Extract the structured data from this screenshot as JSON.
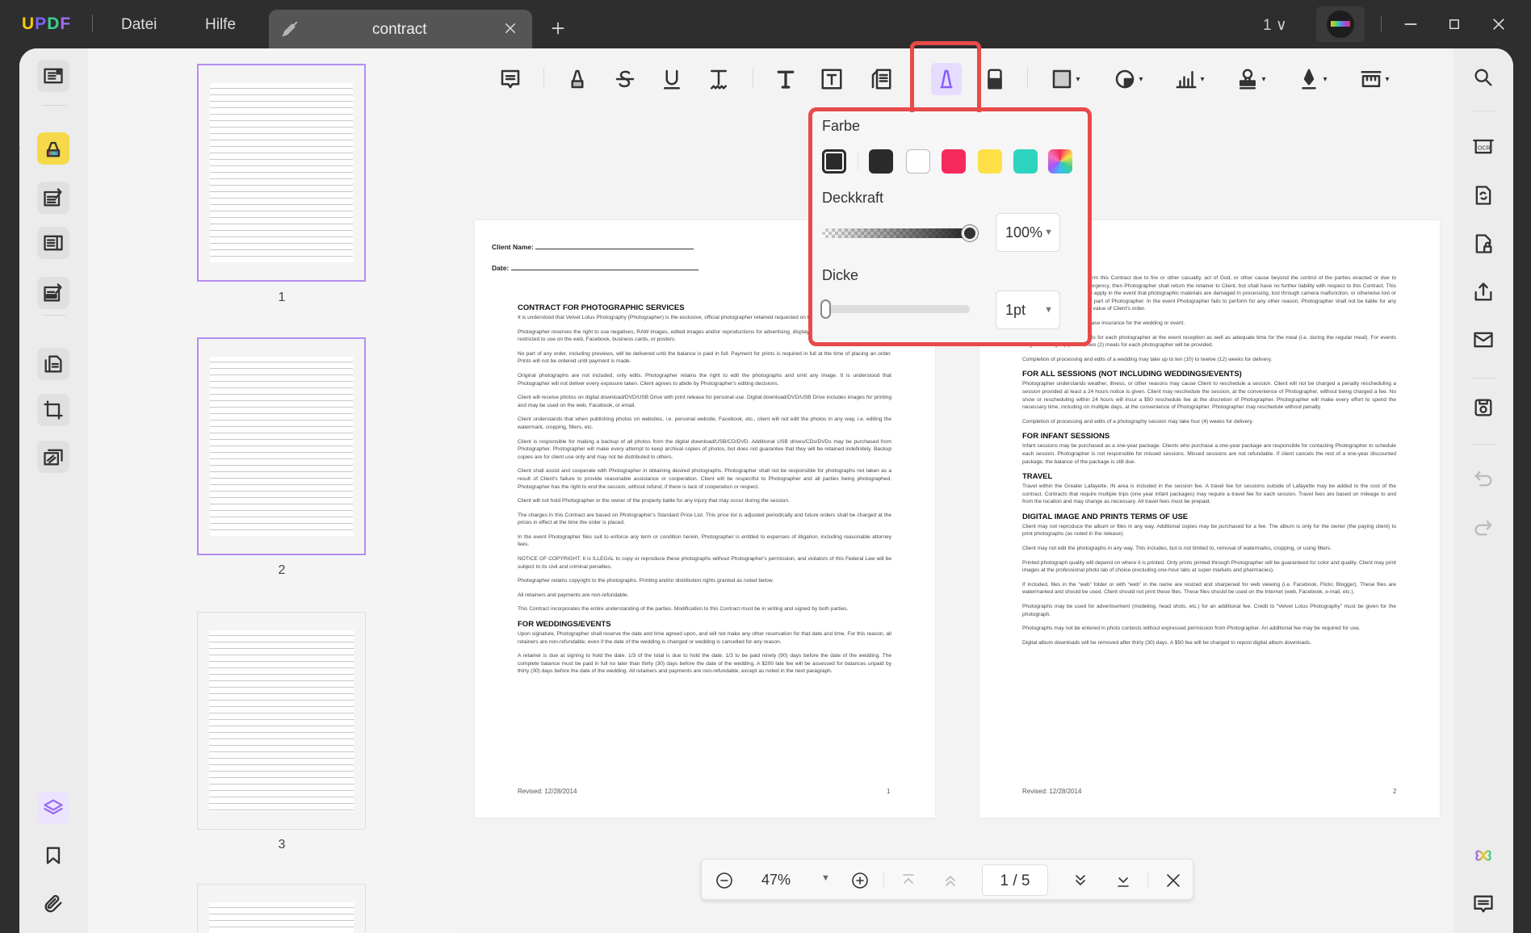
{
  "app": {
    "logo": "UPDF",
    "menu": [
      "Datei",
      "Hilfe"
    ],
    "tab_title": "contract",
    "page_count_indicator": "1"
  },
  "colors": {
    "accent": "#e84a4a",
    "selected_tool_bg": "#e6dcff",
    "highlight_left": "#f6d94a"
  },
  "toolbar": {
    "tools": [
      "comment-icon",
      "highlighter-icon",
      "strikethrough-icon",
      "underline-icon",
      "squiggly-icon",
      "text-icon",
      "textbox-icon",
      "callout-icon",
      "pencil-icon",
      "eraser-icon",
      "rectangle-icon",
      "shape-icon",
      "chart-icon",
      "stamp-icon",
      "signature-icon",
      "ruler-icon"
    ],
    "selected": "pencil-icon"
  },
  "popup": {
    "color_label": "Farbe",
    "swatches": [
      "#2b2b2b",
      "#2b2b2b",
      "#ffffff",
      "#f5295c",
      "#fde047",
      "#2dd4bf",
      "rainbow"
    ],
    "opacity_label": "Deckkraft",
    "opacity_value": "100%",
    "opacity_fraction": 1.0,
    "thickness_label": "Dicke",
    "thickness_value": "1pt"
  },
  "thumbnails": {
    "labels": [
      "1",
      "2",
      "3"
    ]
  },
  "page1": {
    "client_name": "Client Name:",
    "date": "Date:",
    "title": "CONTRACT FOR PHOTOGRAPHIC SERVICES",
    "paragraphs": [
      "It is understood that Velvet Lotus Photography (Photographer) is the exclusive, official photographer retained requested on this contract.",
      "Photographer reserves the right to use negatives, RAW images, edited images and/or reproductions for advertising, display, publication or other purposes, not restricted to use on the web, Facebook, business cards, or posters.",
      "No part of any order, including previews, will be delivered until the balance is paid in full. Payment for prints is required in full at the time of placing an order. Prints will not be ordered until payment is made.",
      "Original photographs are not included, only edits. Photographer retains the right to edit the photographs and omit any image. It is understood that Photographer will not deliver every exposure taken. Client agrees to abide by Photographer's editing decisions.",
      "Client will receive photos on digital download/DVD/USB Drive with print release for personal use. Digital download/DVD/USB Drive includes images for printing and may be used on the web, Facebook, or email.",
      "Client understands that when publishing photos on websites, i.e. personal website, Facebook, etc., client will not edit the photos in any way, i.e. editing the watermark, cropping, filters, etc.",
      "Client is responsible for making a backup of all photos from the digital download/USB/CD/DVD. Additional USB drives/CDs/DVDs may be purchased from Photographer. Photographer will make every attempt to keep archival copies of photos, but does not guarantee that they will be retained indefinitely. Backup copies are for client use only and may not be distributed to others.",
      "Client shall assist and cooperate with Photographer in obtaining desired photographs. Photographer shall not be responsible for photographs not taken as a result of Client's failure to provide reasonable assistance or cooperation. Client will be respectful to Photographer and all parties being photographed. Photographer has the right to end the session, without refund, if there is lack of cooperation or respect.",
      "Client will not hold Photographer or the owner of the property liable for any injury that may occur during the session.",
      "The charges in this Contract are based on Photographer's Standard Price List. This price list is adjusted periodically and future orders shall be charged at the prices in effect at the time the order is placed.",
      "In the event Photographer files suit to enforce any term or condition herein, Photographer is entitled to expenses of litigation, including reasonable attorney fees.",
      "NOTICE OF COPYRIGHT: It is ILLEGAL to copy or reproduce these photographs without Photographer's permission, and violators of this Federal Law will be subject to its civil and criminal penalties.",
      "Photographer retains copyright to the photographs. Printing and/or distribution rights granted as noted below.",
      "All retainers and payments are non-refundable.",
      "This Contract incorporates the entire understanding of the parties. Modification to this Contract must be in writing and signed by both parties."
    ],
    "heading2": "FOR WEDDINGS/EVENTS",
    "paragraphs2": [
      "Upon signature, Photographer shall reserve the date and time agreed upon, and will not make any other reservation for that date and time. For this reason, all retainers are non-refundable, even if the date of the wedding is changed or wedding is cancelled for any reason.",
      "A retainer is due at signing to hold the date. 1/3 of the total is due to hold the date. 1/3 to be paid ninety (90) days before the date of the wedding. The complete balance must be paid in full no later than thirty (30) days before the date of the wedding. A $200 late fee will be assessed for balances unpaid by thirty (30) days before the date of the wedding. All retainers and payments are non-refundable, except as noted in the next paragraph."
    ],
    "footer": "Revised: 12/28/2014",
    "number": "1"
  },
  "page2": {
    "intro": [
      "If Photographer cannot perform this Contract due to fire or other casualty, act of God, or other cause beyond the control of the parties enacted or due to Photographer's illness or emergency, then Photographer shall return the retainer to Client, but shall have no further liability with respect to this Contract. This limitation on liability shall also apply in the event that photographic materials are damaged in processing, lost through camera malfunction, or otherwise lost or damaged without fault on the part of Photographer. In the event Photographer fails to perform for any other reason, Photographer shall not be liable for any amount in excess of the retail value of Client's order.",
      "Client is encouraged to purchase insurance for the wedding or event.",
      "Client agrees to provide meals for each photographer at the event reception as well as adequate time for the meal (i.e. during the regular meal). For events longer than eight (8) hours, two (2) meals for each photographer will be provided.",
      "Completion of processing and edits of a wedding may take up to ten (10) to twelve (12) weeks for delivery."
    ],
    "h_sessions": "FOR ALL SESSIONS (NOT INCLUDING WEDDINGS/EVENTS)",
    "sessions": [
      "Photographer understands weather, illness, or other reasons may cause Client to reschedule a session. Client will not be charged a penalty rescheduling a session provided at least a 24 hours notice is given. Client may reschedule the session, at the convenience of Photographer, without being charged a fee. No show or rescheduling within 24 hours will incur a $50 reschedule fee at the discretion of Photographer. Photographer will make every effort to spend the necessary time, including on multiple days, at the convenience of Photographer. Photographer may reschedule without penalty.",
      "Completion of processing and edits of a photography session may take four (4) weeks for delivery."
    ],
    "h_infant": "FOR INFANT SESSIONS",
    "infant": "Infant sessions may be purchased as a one-year package. Clients who purchase a one-year package are responsible for contacting Photographer to schedule each session. Photographer is not responsible for missed sessions. Missed sessions are not refundable. If client cancels the rest of a one-year discounted package, the balance of the package is still due.",
    "h_travel": "TRAVEL",
    "travel": "Travel within the Greater Lafayette, IN area is included in the session fee. A travel fee for sessions outside of Lafayette may be added to the cost of the contract. Contracts that require multiple trips (one year infant packages) may require a travel fee for each session. Travel fees are based on mileage to and from the location and may change as necessary. All travel fees must be prepaid.",
    "h_digital": "DIGITAL IMAGE AND PRINTS TERMS OF USE",
    "digital": [
      "Client may not reproduce the album or files in any way. Additional copies may be purchased for a fee. The album is only for the owner (the paying client) to print photographs (as noted in the release).",
      "Client may not edit the photographs in any way. This includes, but is not limited to, removal of watermarks, cropping, or using filters.",
      "Printed photograph quality will depend on where it is printed. Only prints printed through Photographer will be guaranteed for color and quality. Client may print images at the professional photo lab of choice (excluding one-hour labs at super markets and pharmacies).",
      "If included, files in the “web” folder or with “web” in the name are resized and sharpened for web viewing (i.e. Facebook, Flickr, Blogger). These files are watermarked and should be used. Client should not print these files. These files should be used on the Internet (web, Facebook, e-mail, etc.).",
      "Photographs may be used for advertisement (modeling, head shots, etc.) for an additional fee. Credit to “Velvet Lotus Photography” must be given for the photograph.",
      "Photographs may not be entered in photo contests without expressed permission from Photographer. An additional fee may be required for use.",
      "Digital album downloads will be removed after thirty (30) days. A $50 fee will be charged to repost digital album downloads."
    ],
    "footer": "Revised: 12/28/2014",
    "number": "2"
  },
  "bottombar": {
    "zoom": "47%",
    "page": "1 / 5"
  }
}
